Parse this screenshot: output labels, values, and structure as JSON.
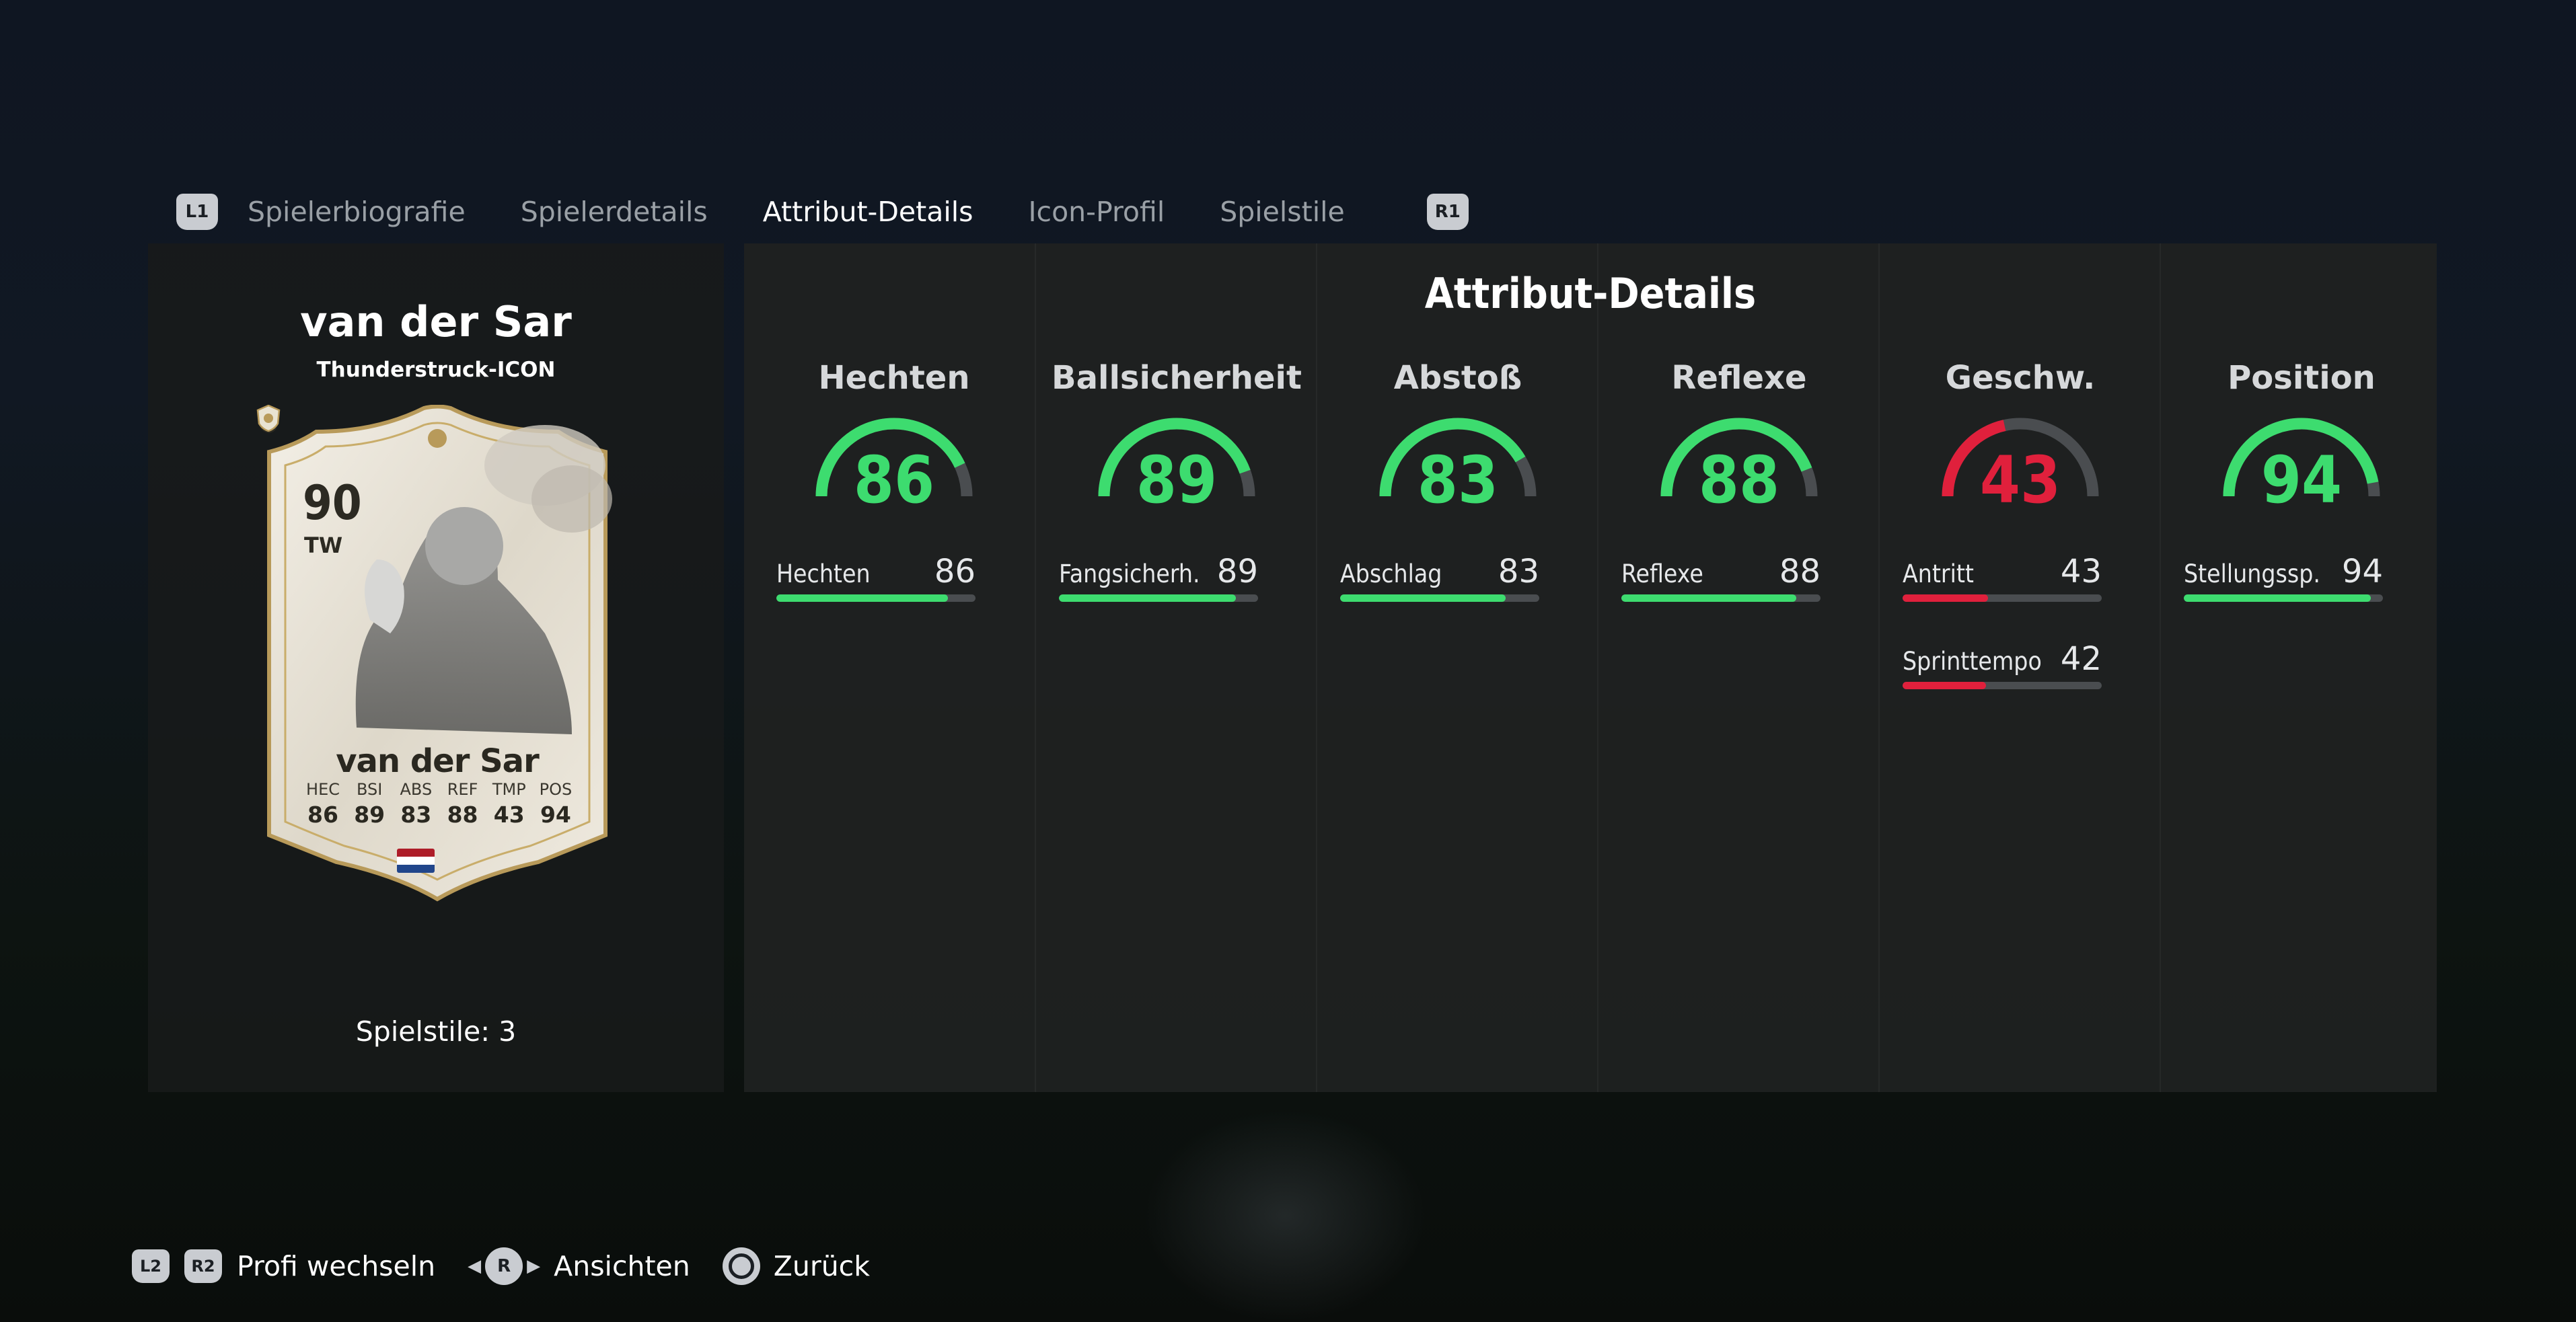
{
  "tabs": {
    "left_button": "L1",
    "right_button": "R1",
    "items": [
      {
        "label": "Spielerbiografie"
      },
      {
        "label": "Spielerdetails"
      },
      {
        "label": "Attribut-Details"
      },
      {
        "label": "Icon-Profil"
      },
      {
        "label": "Spielstile"
      }
    ],
    "active_index": 2
  },
  "player": {
    "name": "van der Sar",
    "edition": "Thunderstruck-ICON",
    "playstyles": "Spielstile: 3",
    "card": {
      "rating": "90",
      "position": "TW",
      "name": "van der Sar",
      "stats": [
        {
          "label": "HEC",
          "value": "86"
        },
        {
          "label": "BSI",
          "value": "89"
        },
        {
          "label": "ABS",
          "value": "83"
        },
        {
          "label": "REF",
          "value": "88"
        },
        {
          "label": "TMP",
          "value": "43"
        },
        {
          "label": "POS",
          "value": "94"
        }
      ],
      "flag_colors": [
        "#ae1c28",
        "#ffffff",
        "#21468b"
      ],
      "icons": [
        "glove-icon",
        "nation-flag-netherlands",
        "icon-badge"
      ]
    }
  },
  "main": {
    "title": "Attribut-Details",
    "colors": {
      "good": "#3ddc6f",
      "bad": "#e0203c",
      "track": "#4a4d50"
    },
    "categories": [
      {
        "name": "Hechten",
        "value": "86",
        "level": 86,
        "color": "#3ddc6f",
        "subs": [
          {
            "label": "Hechten",
            "value": "86",
            "level": 86
          }
        ]
      },
      {
        "name": "Ballsicherheit",
        "value": "89",
        "level": 89,
        "color": "#3ddc6f",
        "subs": [
          {
            "label": "Fangsicherh.",
            "value": "89",
            "level": 89
          }
        ]
      },
      {
        "name": "Abstoß",
        "value": "83",
        "level": 83,
        "color": "#3ddc6f",
        "subs": [
          {
            "label": "Abschlag",
            "value": "83",
            "level": 83
          }
        ]
      },
      {
        "name": "Reflexe",
        "value": "88",
        "level": 88,
        "color": "#3ddc6f",
        "subs": [
          {
            "label": "Reflexe",
            "value": "88",
            "level": 88
          }
        ]
      },
      {
        "name": "Geschw.",
        "value": "43",
        "level": 43,
        "color": "#e0203c",
        "subs": [
          {
            "label": "Antritt",
            "value": "43",
            "level": 43
          },
          {
            "label": "Sprinttempo",
            "value": "42",
            "level": 42
          }
        ]
      },
      {
        "name": "Position",
        "value": "94",
        "level": 94,
        "color": "#3ddc6f",
        "subs": [
          {
            "label": "Stellungssp.",
            "value": "94",
            "level": 94
          }
        ]
      }
    ]
  },
  "controls": {
    "l2": "L2",
    "r2": "R2",
    "switch_label": "Profi wechseln",
    "stick": "R",
    "views_label": "Ansichten",
    "back_label": "Zurück"
  }
}
